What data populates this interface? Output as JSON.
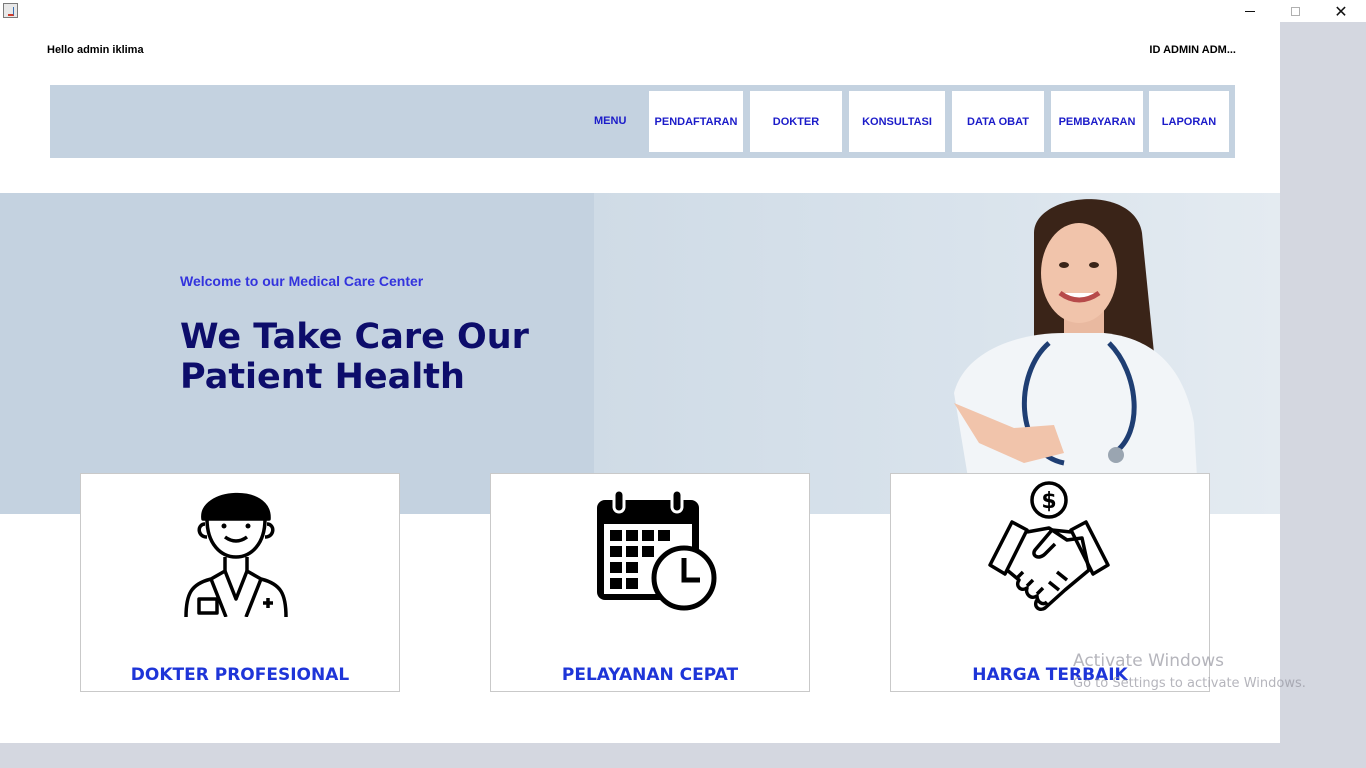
{
  "window": {
    "close_glyph": "✕",
    "icon": "java-app-icon"
  },
  "header": {
    "greeting": "Hello admin  iklima",
    "admin_id": "ID ADMIN  ADM..."
  },
  "nav": {
    "menu_label": "MENU",
    "items": [
      {
        "label": "PENDAFTARAN"
      },
      {
        "label": "DOKTER"
      },
      {
        "label": "KONSULTASI"
      },
      {
        "label": "DATA OBAT"
      },
      {
        "label": "PEMBAYARAN"
      },
      {
        "label": "LAPORAN"
      }
    ]
  },
  "hero": {
    "subtitle": "Welcome to our Medical Care Center",
    "title_line1": "We Take Care Our",
    "title_line2": "Patient Health"
  },
  "features": [
    {
      "title": "DOKTER PROFESIONAL",
      "icon": "doctor-icon"
    },
    {
      "title": "PELAYANAN CEPAT",
      "icon": "calendar-clock-icon"
    },
    {
      "title": "HARGA TERBAIK",
      "icon": "handshake-money-icon"
    }
  ],
  "watermark": {
    "line1": "Activate Windows",
    "line2": "Go to Settings to activate Windows."
  },
  "colors": {
    "nav_bg": "#c4d2e0",
    "nav_text": "#1b1bc9",
    "hero_title": "#0d0d6b",
    "card_title": "#1e35d8"
  }
}
